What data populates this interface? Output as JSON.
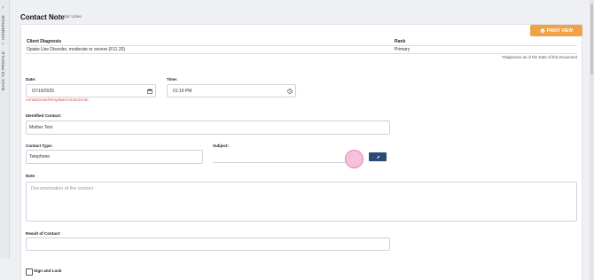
{
  "sidebar": {
    "homepage_label": "HOMEPAGE",
    "back_label": "BACK TO PROFILE"
  },
  "header": {
    "title": "Contact Note",
    "subtitle": "Portal Video"
  },
  "toolbar": {
    "print_label": "PRINT VIEW"
  },
  "diagnosis": {
    "columns": [
      "Client Diagnosis",
      "Rank"
    ],
    "rows": [
      [
        "Opiate Use Disorder, moderate or severe (F11.20)",
        "Primary"
      ]
    ],
    "footnote": "*Diagnoses as of the Date of this Document"
  },
  "form": {
    "date": {
      "label": "Date:",
      "value": "07/19/2025"
    },
    "time": {
      "label": "Time:",
      "value": "01:19 PM"
    },
    "template_path": "contactnote/template/contactnote",
    "identified_contact": {
      "label": "Identified Contact:",
      "value": "Mother Test"
    },
    "contact_type": {
      "label": "Contact Type:",
      "value": "Telephone"
    },
    "subject": {
      "label": "Subject:",
      "value": ""
    },
    "note": {
      "label": "Note",
      "placeholder": "Documentation of the contact"
    },
    "result": {
      "label": "Result of Contact:",
      "value": ""
    },
    "sign_lock": {
      "label": "Sign and Lock",
      "checked": false
    }
  },
  "icons": {
    "print": "printer-icon",
    "calendar": "calendar-icon",
    "clock": "clock-icon",
    "edit": "pencil-icon"
  },
  "colors": {
    "print_button": "#f0a24a",
    "edit_button": "#2b4c76",
    "error_text": "#d9534f"
  }
}
